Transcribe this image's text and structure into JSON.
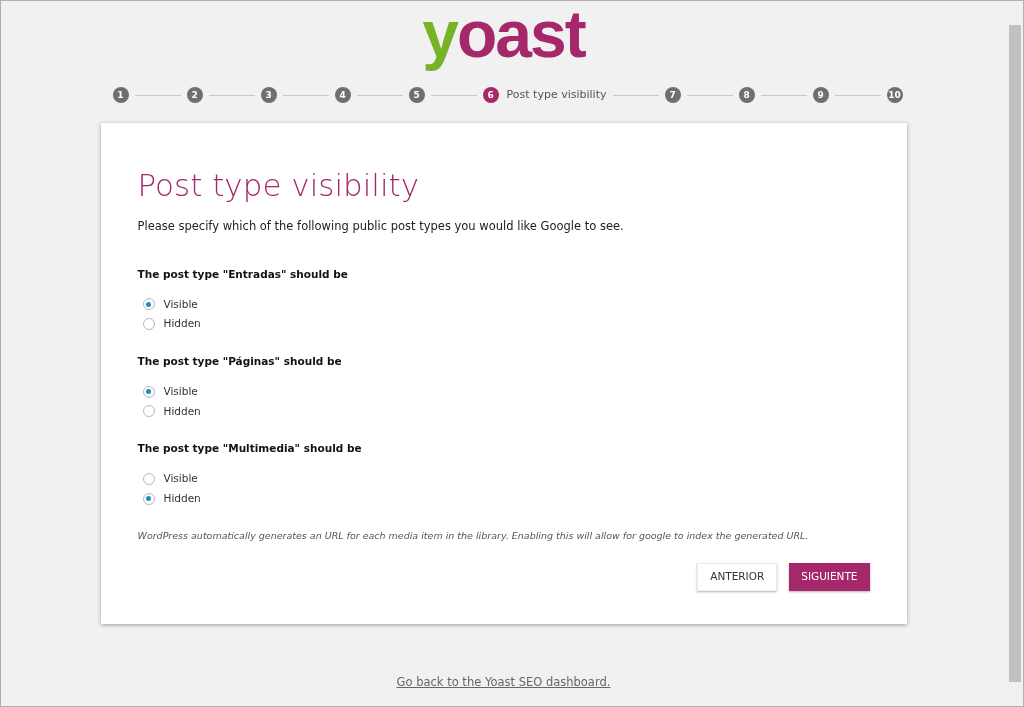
{
  "logo": {
    "text": "yoast"
  },
  "steps": [
    {
      "number": "1",
      "selected": false
    },
    {
      "number": "2",
      "selected": false
    },
    {
      "number": "3",
      "selected": false
    },
    {
      "number": "4",
      "selected": false
    },
    {
      "number": "5",
      "selected": false
    },
    {
      "number": "6",
      "label": "Post type visibility",
      "selected": true
    },
    {
      "number": "7",
      "selected": false
    },
    {
      "number": "8",
      "selected": false
    },
    {
      "number": "9",
      "selected": false
    },
    {
      "number": "10",
      "selected": false
    }
  ],
  "card": {
    "title": "Post type visibility",
    "intro": "Please specify which of the following public post types you would like Google to see.",
    "groups": [
      {
        "question": "The post type \"Entradas\" should be",
        "options": [
          {
            "label": "Visible",
            "selected": true
          },
          {
            "label": "Hidden",
            "selected": false
          }
        ]
      },
      {
        "question": "The post type \"Páginas\" should be",
        "options": [
          {
            "label": "Visible",
            "selected": true
          },
          {
            "label": "Hidden",
            "selected": false
          }
        ]
      },
      {
        "question": "The post type \"Multimedia\" should be",
        "options": [
          {
            "label": "Visible",
            "selected": false
          },
          {
            "label": "Hidden",
            "selected": true
          }
        ]
      }
    ],
    "note": "WordPress automatically generates an URL for each media item in the library. Enabling this will allow for google to index the generated URL.",
    "buttons": [
      {
        "label": "ANTERIOR",
        "kind": "secondary"
      },
      {
        "label": "SIGUIENTE",
        "kind": "primary"
      }
    ]
  },
  "footer_link": "Go back to the Yoast SEO dashboard."
}
